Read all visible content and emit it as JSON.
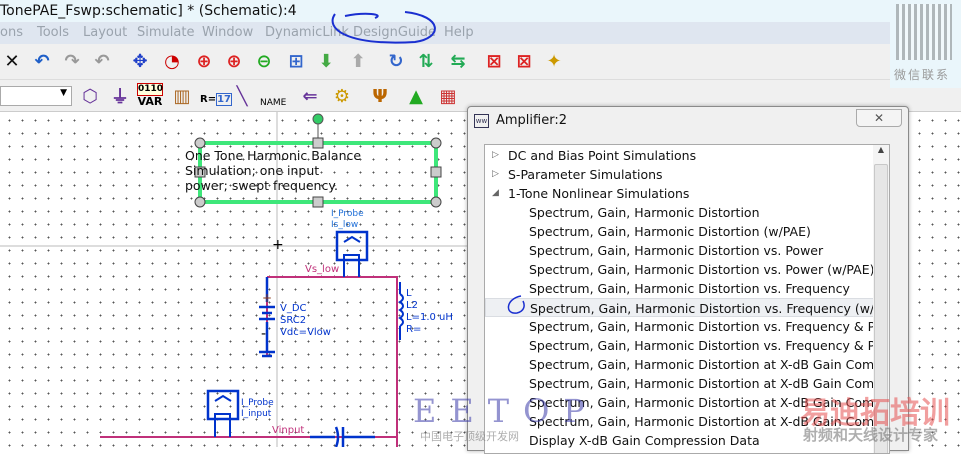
{
  "window": {
    "title": "TonePAE_Fswp:schematic] * (Schematic):4"
  },
  "menu": [
    "ons",
    "Tools",
    "Layout",
    "Simulate",
    "Window",
    "DynamicLink",
    "DesignGuide",
    "Help"
  ],
  "toolbar2": {
    "var_label_top": "0110",
    "var_label": "VAR",
    "r_label": "R=",
    "r_value": "17",
    "name_label": "NAME"
  },
  "schematic": {
    "note": [
      "One Tone Harmonic Balance",
      "Simulation; one input",
      "power; swept frequency."
    ],
    "probe1": {
      "type": "I_Probe",
      "name": "Is_low"
    },
    "probe2": {
      "type": "I_Probe",
      "name": "I_input"
    },
    "net1": "Vs_low",
    "net2": "Vinput",
    "src": {
      "type": "V_DC",
      "name": "SRC2",
      "param": "Vdc=Vlow"
    },
    "ind": {
      "type": "L",
      "name": "L2",
      "l": "L=1.0 uH",
      "r": "R="
    }
  },
  "dialog": {
    "title": "Amplifier:2",
    "close": "✕",
    "items": [
      {
        "label": "DC and Bias Point Simulations",
        "level": 0,
        "arrow": "▷"
      },
      {
        "label": "S-Parameter Simulations",
        "level": 0,
        "arrow": "▷"
      },
      {
        "label": "1-Tone Nonlinear Simulations",
        "level": 0,
        "arrow": "◢"
      },
      {
        "label": "Spectrum, Gain, Harmonic Distortion",
        "level": 1
      },
      {
        "label": "Spectrum, Gain, Harmonic Distortion (w/PAE)",
        "level": 1
      },
      {
        "label": "Spectrum, Gain, Harmonic Distortion vs. Power",
        "level": 1
      },
      {
        "label": "Spectrum, Gain, Harmonic Distortion vs. Power (w/PAE)",
        "level": 1
      },
      {
        "label": "Spectrum, Gain, Harmonic Distortion vs. Frequency",
        "level": 1
      },
      {
        "label": "Spectrum, Gain, Harmonic Distortion vs. Frequency (w/PAE)",
        "level": 1,
        "selected": true
      },
      {
        "label": "Spectrum, Gain, Harmonic Distortion vs. Frequency & Power",
        "level": 1
      },
      {
        "label": "Spectrum, Gain, Harmonic Distortion vs. Frequency & Power",
        "level": 1
      },
      {
        "label": "Spectrum, Gain, Harmonic Distortion at X-dB Gain Compression",
        "level": 1
      },
      {
        "label": "Spectrum, Gain, Harmonic Distortion at X-dB Gain Compression",
        "level": 1
      },
      {
        "label": "Spectrum, Gain, Harmonic Distortion at X-dB Gain Compression",
        "level": 1
      },
      {
        "label": "Spectrum, Gain, Harmonic Distortion at X-dB Gain Compression",
        "level": 1
      },
      {
        "label": "Display X-dB Gain Compression Data",
        "level": 1
      }
    ]
  },
  "watermarks": {
    "eetop": "EETOP",
    "eetop_sub": "中国电子顶级开发网",
    "brand": "易迪拓培训",
    "brand_sub": "射频和天线设计专家",
    "wechat": "微信联系"
  }
}
